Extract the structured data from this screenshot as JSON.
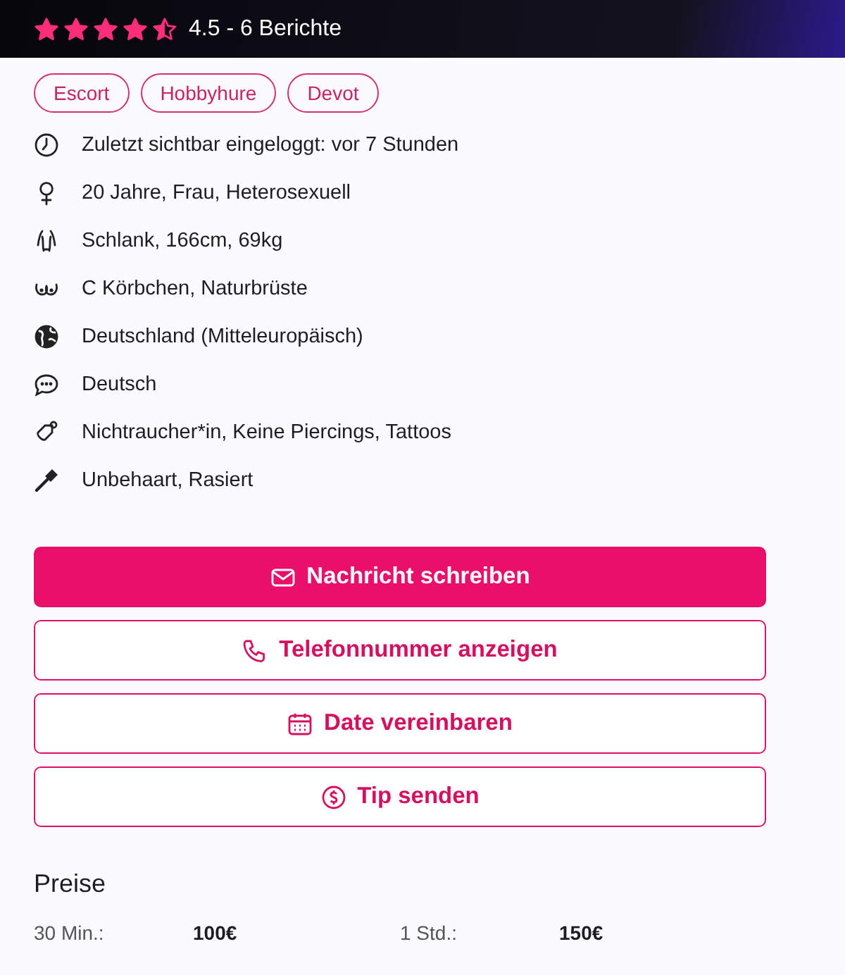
{
  "rating": {
    "stars": 4.5,
    "text": "4.5 - 6 Berichte"
  },
  "tags": [
    "Escort",
    "Hobbyhure",
    "Devot"
  ],
  "details": [
    {
      "kind": "clock",
      "text": "Zuletzt sichtbar eingeloggt: vor 7 Stunden"
    },
    {
      "kind": "female",
      "text": "20 Jahre, Frau, Heterosexuell"
    },
    {
      "kind": "figure",
      "text": "Schlank, 166cm, 69kg"
    },
    {
      "kind": "curves",
      "text": "C Körbchen, Naturbrüste"
    },
    {
      "kind": "globe",
      "text": "Deutschland (Mitteleuropäisch)"
    },
    {
      "kind": "chat",
      "text": "Deutsch"
    },
    {
      "kind": "tag",
      "text": "Nichtraucher*in, Keine Piercings, Tattoos"
    },
    {
      "kind": "razor",
      "text": "Unbehaart, Rasiert"
    }
  ],
  "actions": [
    {
      "kind": "mail",
      "label": "Nachricht schreiben",
      "primary": true
    },
    {
      "kind": "phone",
      "label": "Telefonnummer anzeigen",
      "primary": false
    },
    {
      "kind": "calendar",
      "label": "Date vereinbaren",
      "primary": false
    },
    {
      "kind": "coin",
      "label": "Tip senden",
      "primary": false
    }
  ],
  "prices": {
    "title": "Preise",
    "items": [
      {
        "duration": "30 Min.:",
        "price": "100€"
      },
      {
        "duration": "1 Std.:",
        "price": "150€"
      }
    ]
  }
}
